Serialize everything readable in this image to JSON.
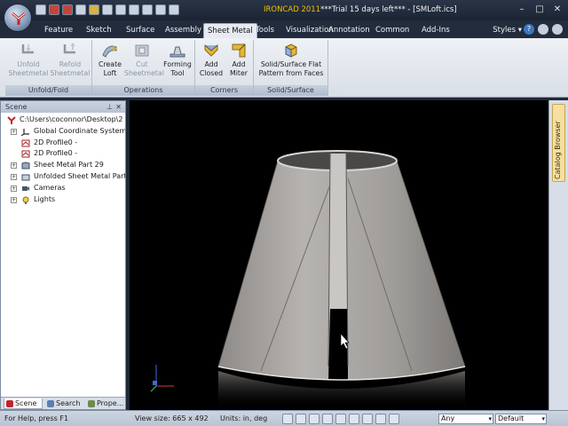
{
  "window": {
    "title_product": "IRONCAD 2011",
    "title_rest": "***Trial 15 days left*** - [SMLoft.ics]",
    "minimize": "–",
    "maximize": "□",
    "close": "✕"
  },
  "ribbon": {
    "tabs": [
      {
        "label": "Feature"
      },
      {
        "label": "Sketch"
      },
      {
        "label": "Surface"
      },
      {
        "label": "Assembly"
      },
      {
        "label": "Sheet Metal"
      },
      {
        "label": "Tools"
      },
      {
        "label": "Visualization"
      },
      {
        "label": "Annotation"
      },
      {
        "label": "Common"
      },
      {
        "label": "Add-Ins"
      }
    ],
    "styles_label": "Styles",
    "groups": {
      "unfold": {
        "label": "Unfold/Fold",
        "unfold_line1": "Unfold",
        "unfold_line2": "Sheetmetal",
        "refold_line1": "Refold",
        "refold_line2": "Sheetmetal"
      },
      "operations": {
        "label": "Operations",
        "loft_line1": "Create",
        "loft_line2": "Loft",
        "cut_line1": "Cut",
        "cut_line2": "Sheetmetal",
        "forming_line1": "Forming",
        "forming_line2": "Tool"
      },
      "corners": {
        "label": "Corners",
        "closed_line1": "Add",
        "closed_line2": "Closed",
        "miter_line1": "Add",
        "miter_line2": "Miter"
      },
      "solid": {
        "label": "Solid/Surface",
        "flat_line1": "Solid/Surface Flat",
        "flat_line2": "Pattern from Faces"
      }
    }
  },
  "scene_panel": {
    "title": "Scene",
    "pin": "⊥",
    "close": "✕",
    "tree": [
      {
        "label": "C:\\Users\\coconnor\\Desktop\\2"
      },
      {
        "label": "Global Coordinate System"
      },
      {
        "label": "2D Profile0 -"
      },
      {
        "label": "2D Profile0 -"
      },
      {
        "label": "Sheet Metal Part 29"
      },
      {
        "label": "Unfolded Sheet Metal Part"
      },
      {
        "label": "Cameras"
      },
      {
        "label": "Lights"
      }
    ],
    "tabs": [
      {
        "label": "Scene"
      },
      {
        "label": "Search"
      },
      {
        "label": "Prope..."
      }
    ]
  },
  "catalog_browser": {
    "label": "Catalog Browser"
  },
  "statusbar": {
    "help": "For Help, press F1",
    "view_size": "View size: 665 x 492",
    "units": "Units: in, deg",
    "filter_value": "Any",
    "style_value": "Default"
  },
  "colors": {
    "frame": "#1f2a3a",
    "ribbon_bg": "#e4e8ee",
    "viewport_bg": "#000000",
    "part_gray": "#a9a6a4",
    "highlight_tab": "#f6dfa1"
  }
}
